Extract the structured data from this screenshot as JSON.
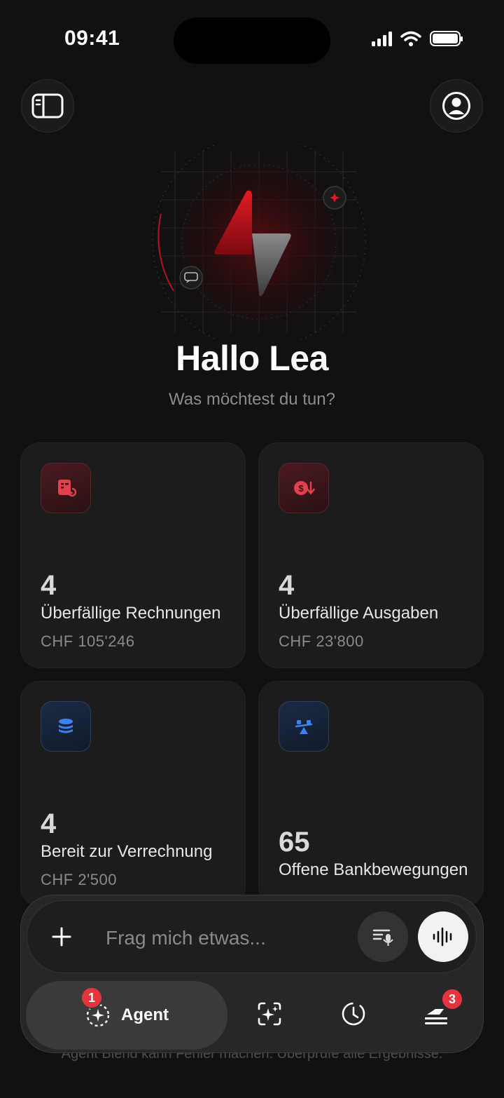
{
  "status_bar": {
    "time": "09:41"
  },
  "header": {
    "sidebar_icon": "sidebar-toggle-icon",
    "profile_icon": "user-circle-icon"
  },
  "hero": {
    "greeting": "Hallo Lea",
    "subtitle": "Was möchtest du tun?"
  },
  "cards": [
    {
      "count": "4",
      "title": "Überfällige Rechnungen",
      "amount": "CHF 105'246",
      "icon": "invoice-refresh-icon",
      "accent": "#e2404d"
    },
    {
      "count": "4",
      "title": "Überfällige Ausgaben",
      "amount": "CHF 23'800",
      "icon": "dollar-down-icon",
      "accent": "#e2404d"
    },
    {
      "count": "4",
      "title": "Bereit zur Verrechnung",
      "amount": "CHF 2'500",
      "icon": "coins-stack-icon",
      "accent": "#3b82f6"
    },
    {
      "count": "65",
      "title": "Offene Bankbewegungen",
      "amount": "",
      "icon": "bank-transfer-icon",
      "accent": "#3b82f6"
    }
  ],
  "chat": {
    "placeholder": "Frag mich etwas...",
    "plus_icon": "plus-icon",
    "dictate_icon": "dictation-icon",
    "voice_icon": "voice-waveform-icon"
  },
  "nav": {
    "agent_label": "Agent",
    "agent_badge": "1",
    "inbox_badge": "3",
    "items": [
      "agent",
      "magic-tasks",
      "history",
      "inbox"
    ]
  },
  "disclaimer": "Agent Blend kann Fehler machen. Überprüfe alle Ergebnisse.",
  "colors": {
    "background": "#111111",
    "card": "#1c1c1c",
    "badge": "#e5343d",
    "brand_red": "#c0141f"
  }
}
